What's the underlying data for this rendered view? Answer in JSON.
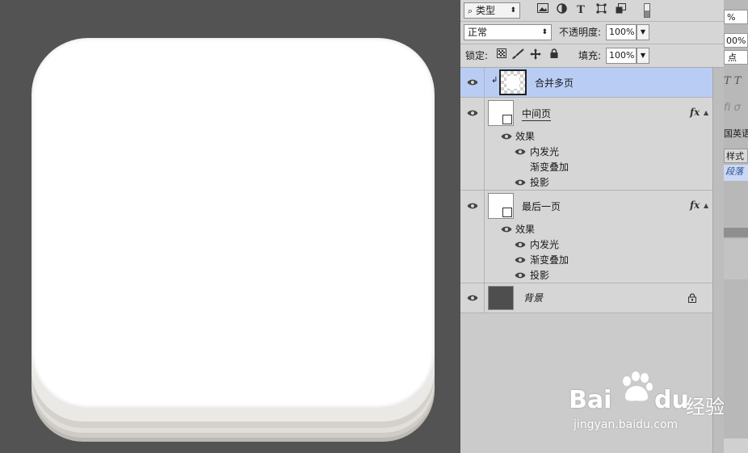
{
  "toolbar": {
    "kind_label": "类型",
    "blend_mode": "正常",
    "opacity_label": "不透明度:",
    "opacity_value": "100%",
    "lock_label": "锁定:",
    "fill_label": "填充:",
    "fill_value": "100%"
  },
  "layers": [
    {
      "name": "合并多页",
      "selected": true
    },
    {
      "name": "中间页",
      "effects_label": "效果",
      "effects": [
        "内发光",
        "渐变叠加",
        "投影"
      ],
      "effect_visible": [
        true,
        false,
        true
      ]
    },
    {
      "name": "最后一页",
      "effects_label": "效果",
      "effects": [
        "内发光",
        "渐变叠加",
        "投影"
      ],
      "effect_visible": [
        true,
        true,
        true
      ]
    },
    {
      "name": "背景",
      "locked": true
    }
  ],
  "fx_label": "fx",
  "right_strip": {
    "percent_1": "%",
    "percent_2": "00%",
    "unit": "点",
    "lang": "国英语",
    "style_tab": "样式",
    "para_item": "段落"
  },
  "watermark": {
    "brand_left": "Bai",
    "brand_right": "du",
    "brand_cn": "经验",
    "url": "jingyan.baidu.com"
  },
  "colors": {
    "selected_row": "#b9cdf4",
    "panel_bg": "#d6d6d6",
    "canvas_bg": "#535353"
  }
}
